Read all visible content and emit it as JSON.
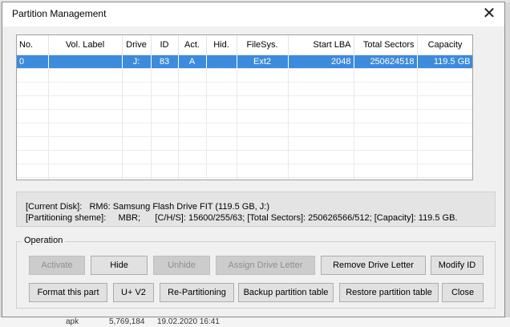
{
  "dialog": {
    "title": "Partition Management",
    "close_glyph": "✕"
  },
  "table": {
    "columns": [
      "No.",
      "Vol. Label",
      "Drive",
      "ID",
      "Act.",
      "Hid.",
      "FileSys.",
      "Start LBA",
      "Total Sectors",
      "Capacity"
    ],
    "rows": [
      {
        "no": "0",
        "vol_label": "",
        "drive": "J:",
        "id": "83",
        "act": "A",
        "hid": "",
        "filesys": "Ext2",
        "start_lba": "2048",
        "total_sectors": "250624518",
        "capacity": "119.5 GB"
      }
    ]
  },
  "info": {
    "line1": "[Current Disk]:   RM6: Samsung Flash Drive FIT (119.5 GB, J:)",
    "line2": "[Partitioning sheme]:     MBR;      [C/H/S]: 15600/255/63; [Total Sectors]: 250626566/512; [Capacity]: 119.5 GB."
  },
  "operation": {
    "label": "Operation",
    "row1": [
      {
        "label": "Activate",
        "enabled": false
      },
      {
        "label": "Hide",
        "enabled": true
      },
      {
        "label": "Unhide",
        "enabled": false
      },
      {
        "label": "Assign Drive Letter",
        "enabled": false
      },
      {
        "label": "Remove Drive Letter",
        "enabled": true
      },
      {
        "label": "Modify ID",
        "enabled": true
      }
    ],
    "row2": [
      {
        "label": "Format this part",
        "enabled": true
      },
      {
        "label": "U+ V2",
        "enabled": true
      },
      {
        "label": "Re-Partitioning",
        "enabled": true
      },
      {
        "label": "Backup partition table",
        "enabled": true
      },
      {
        "label": "Restore partition table",
        "enabled": true
      },
      {
        "label": "Close",
        "enabled": true
      }
    ]
  },
  "background": {
    "peek_name": "apk",
    "peek_size": "5,769,184",
    "peek_date": "19.02.2020 16:41"
  }
}
